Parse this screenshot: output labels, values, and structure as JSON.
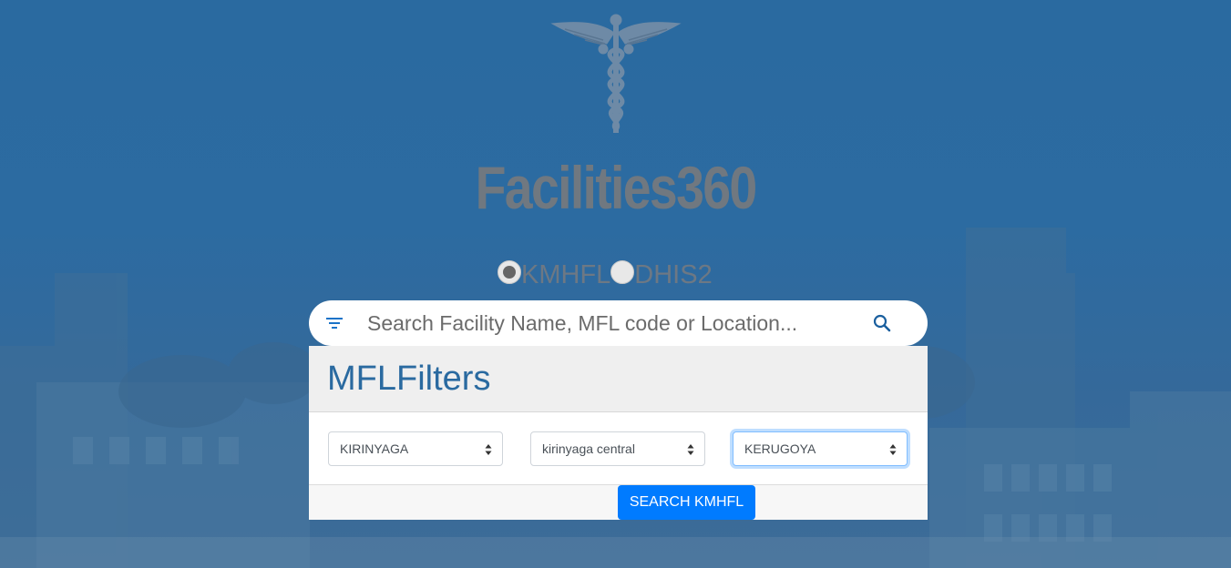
{
  "app": {
    "brand": "Facilities360"
  },
  "source_toggle": {
    "options": [
      {
        "label": "KMHFL",
        "selected": true
      },
      {
        "label": "DHIS2",
        "selected": false
      }
    ]
  },
  "search": {
    "placeholder": "Search Facility Name, MFL code or Location...",
    "value": ""
  },
  "filters": {
    "title": "MFLFilters",
    "county": "KIRINYAGA",
    "subcounty": "kirinyaga central",
    "ward": "KERUGOYA",
    "submit_label": "SEARCH KMHFL"
  },
  "colors": {
    "background": "#2c6ba1",
    "title_blue": "#2a6aa0",
    "primary_button": "#007bff",
    "brand_gray": "#707880"
  },
  "icons": {
    "logo": "caduceus-icon",
    "filter": "filter-icon",
    "search": "search-icon"
  }
}
